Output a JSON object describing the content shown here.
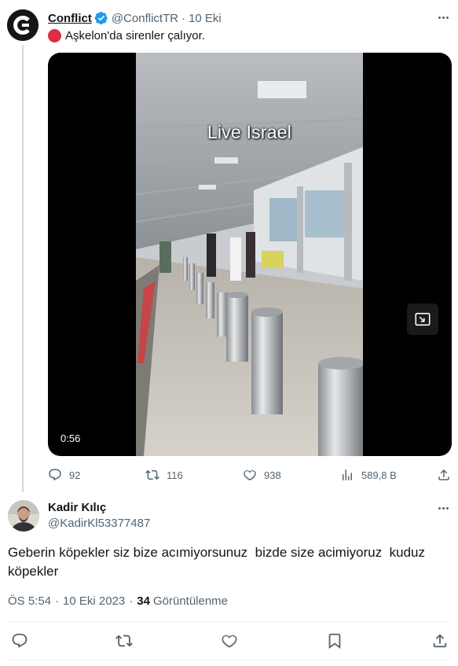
{
  "parent_tweet": {
    "author_name": "Conflict",
    "author_handle": "@ConflictTR",
    "separator": "·",
    "date": "10 Eki",
    "text": "Aşkelon'da sirenler çalıyor.",
    "media": {
      "caption": "Live Israel",
      "duration": "0:56"
    },
    "actions": {
      "replies": "92",
      "reposts": "116",
      "likes": "938",
      "views": "589,8 B"
    }
  },
  "tweet": {
    "author_name": "Kadir Kılıç",
    "author_handle": "@KadirKl53377487",
    "text": "Geberin köpekler siz bize acımiyorsunuz  bizde size acimiyoruz  kuduz\nköpekler",
    "time": "ÖS 5:54",
    "separator": "·",
    "date": "10 Eki 2023",
    "views_count": "34",
    "views_label": "Görüntülenme"
  },
  "colors": {
    "verified_blue": "#1d9bf0",
    "muted_text": "#536471",
    "primary_text": "#0f1419",
    "emoji_red": "#dd2e44"
  },
  "icons": [
    "conflict-logo-icon",
    "verified-badge-icon",
    "more-icon",
    "red-circle-icon",
    "pip-icon",
    "reply-icon",
    "repost-icon",
    "like-icon",
    "views-icon",
    "share-icon",
    "bookmark-icon"
  ]
}
